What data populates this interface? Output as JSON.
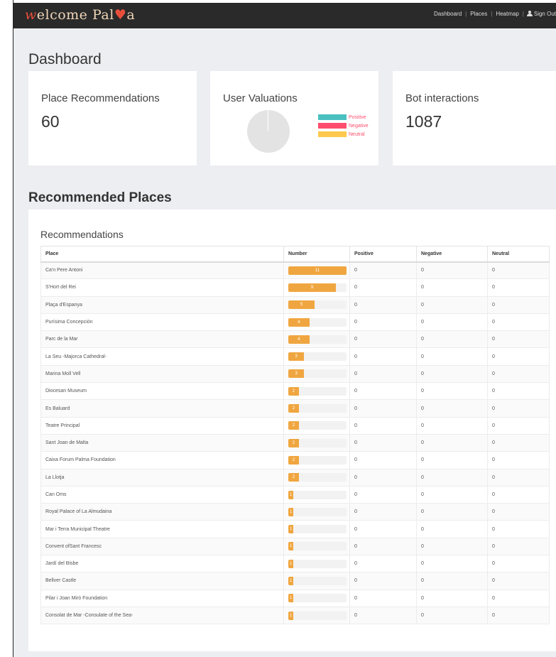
{
  "header": {
    "brand_prefix": "w",
    "brand_mid": "elcome Pal",
    "brand_heart": "♥",
    "brand_suffix": "a",
    "nav": [
      "Dashboard",
      "Places",
      "Heatmap"
    ],
    "signout_label": "Sign Out"
  },
  "dashboard": {
    "title": "Dashboard",
    "cards": {
      "recommendations": {
        "title": "Place Recommendations",
        "value": "60"
      },
      "valuations": {
        "title": "User Valuations",
        "legend": [
          {
            "label": "Positive",
            "color": "#4bc0c0"
          },
          {
            "label": "Negative",
            "color": "#ff4d6d"
          },
          {
            "label": "Neutral",
            "color": "#ffc94d"
          }
        ]
      },
      "bot": {
        "title": "Bot interactions",
        "value": "1087"
      }
    }
  },
  "recommended": {
    "section_title": "Recommended Places",
    "panel_title": "Recommendations",
    "max_number": 11,
    "columns": [
      "Place",
      "Number",
      "Positive",
      "Negative",
      "Neutral"
    ],
    "rows": [
      {
        "place": "Ca'n Pere Antoni",
        "number": 11,
        "positive": "0",
        "negative": "0",
        "neutral": "0"
      },
      {
        "place": "S'Hort del Rei",
        "number": 9,
        "positive": "0",
        "negative": "0",
        "neutral": "0"
      },
      {
        "place": "Plaça d'Espanya",
        "number": 5,
        "positive": "0",
        "negative": "0",
        "neutral": "0"
      },
      {
        "place": "Purísima Concepción",
        "number": 4,
        "positive": "0",
        "negative": "0",
        "neutral": "0"
      },
      {
        "place": "Parc de la Mar",
        "number": 4,
        "positive": "0",
        "negative": "0",
        "neutral": "0"
      },
      {
        "place": "La Seu -Majorca Cathedral-",
        "number": 3,
        "positive": "0",
        "negative": "0",
        "neutral": "0"
      },
      {
        "place": "Marina Moll Vell",
        "number": 3,
        "positive": "0",
        "negative": "0",
        "neutral": "0"
      },
      {
        "place": "Diocesan Museum",
        "number": 2,
        "positive": "0",
        "negative": "0",
        "neutral": "0"
      },
      {
        "place": "Es Baluard",
        "number": 2,
        "positive": "0",
        "negative": "0",
        "neutral": "0"
      },
      {
        "place": "Teatre Principal",
        "number": 2,
        "positive": "0",
        "negative": "0",
        "neutral": "0"
      },
      {
        "place": "Sant Joan de Malta",
        "number": 2,
        "positive": "0",
        "negative": "0",
        "neutral": "0"
      },
      {
        "place": "Caixa Forum Palma Foundation",
        "number": 2,
        "positive": "0",
        "negative": "0",
        "neutral": "0"
      },
      {
        "place": "La Llotja",
        "number": 2,
        "positive": "0",
        "negative": "0",
        "neutral": "0"
      },
      {
        "place": "Can Oms",
        "number": 1,
        "positive": "0",
        "negative": "0",
        "neutral": "0"
      },
      {
        "place": "Royal Palace of La Almudaina",
        "number": 1,
        "positive": "0",
        "negative": "0",
        "neutral": "0"
      },
      {
        "place": "Mar i Terra Municipal Theatre",
        "number": 1,
        "positive": "0",
        "negative": "0",
        "neutral": "0"
      },
      {
        "place": "Convent ofSant Francesc",
        "number": 1,
        "positive": "0",
        "negative": "0",
        "neutral": "0"
      },
      {
        "place": "Jardí del Bisbe",
        "number": 1,
        "positive": "0",
        "negative": "0",
        "neutral": "0"
      },
      {
        "place": "Bellver Castle",
        "number": 1,
        "positive": "0",
        "negative": "0",
        "neutral": "0"
      },
      {
        "place": "Pilar i Joan Miró Foundation",
        "number": 1,
        "positive": "0",
        "negative": "0",
        "neutral": "0"
      },
      {
        "place": "Consolat de Mar -Consulate of the Sea-",
        "number": 1,
        "positive": "0",
        "negative": "0",
        "neutral": "0"
      }
    ]
  }
}
